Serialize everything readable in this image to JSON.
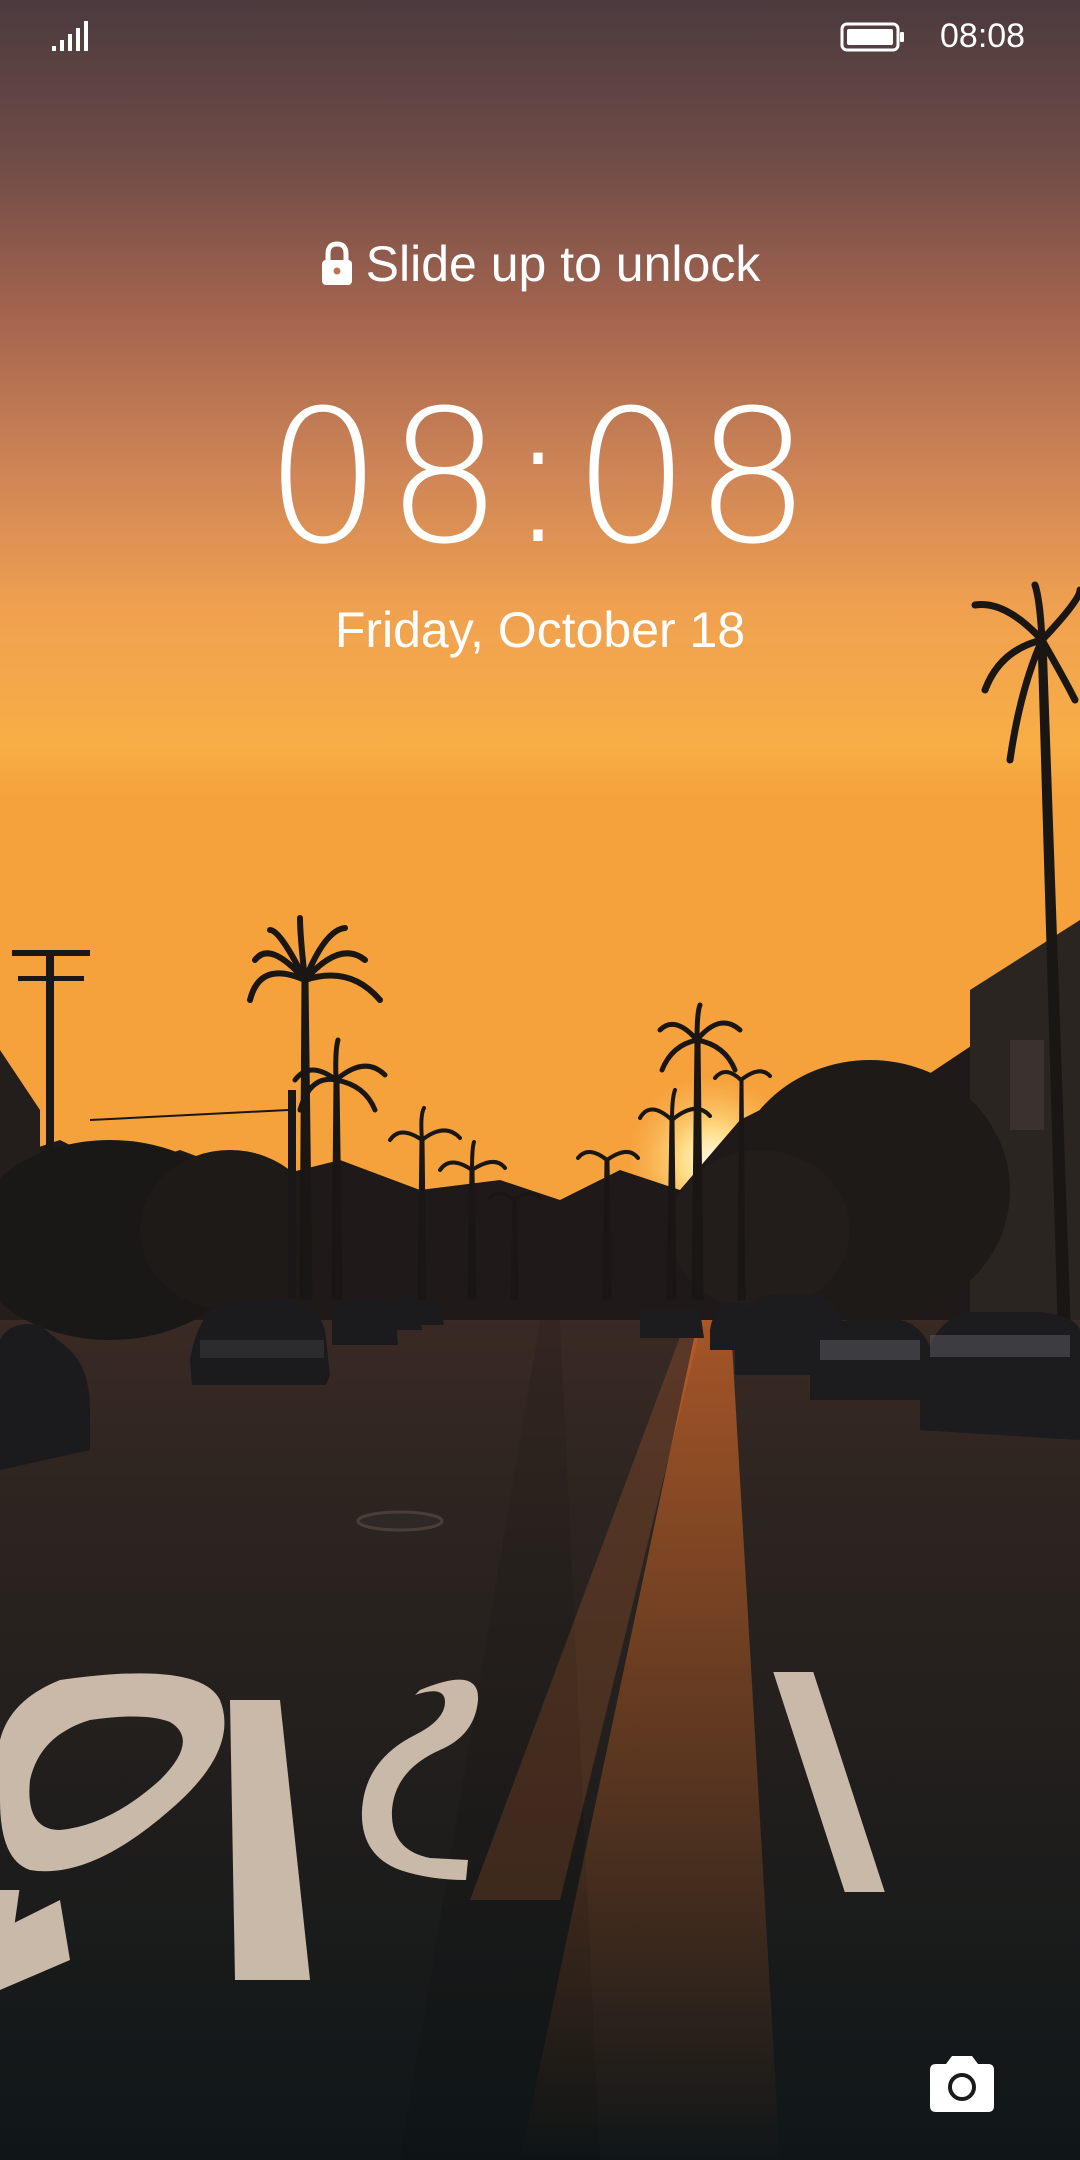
{
  "status_bar": {
    "time": "08:08",
    "signal_icon": "signal-bars-icon",
    "battery_icon": "battery-full-icon"
  },
  "lock_screen": {
    "unlock_hint": "Slide up to unlock",
    "lock_icon": "lock-icon",
    "clock": "08:08",
    "date": "Friday, October 18",
    "camera_icon": "camera-icon"
  },
  "wallpaper": {
    "road_marking": "STOP",
    "colors": {
      "sky_top": "#4b3a3e",
      "sky_mid": "#c27a55",
      "horizon": "#f6a94a",
      "sun": "#fff2c4",
      "road": "#1d1a19"
    }
  }
}
